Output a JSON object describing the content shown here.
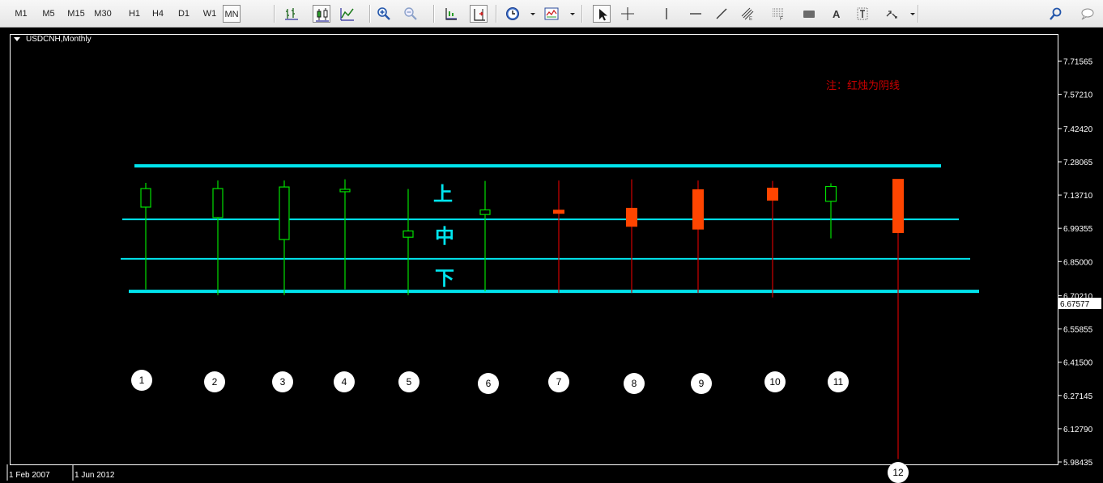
{
  "toolbar": {
    "timeframes": [
      "M1",
      "M5",
      "M15",
      "M30",
      "H1",
      "H4",
      "D1",
      "W1",
      "MN"
    ],
    "active_timeframe": "MN",
    "tools": [
      {
        "name": "bar-chart-icon",
        "active": false
      },
      {
        "name": "candlestick-chart-icon",
        "active": true
      },
      {
        "name": "line-chart-icon",
        "active": false
      },
      {
        "name": "zoom-in-icon",
        "active": false
      },
      {
        "name": "zoom-out-icon",
        "active": false
      },
      {
        "name": "chart-shift-icon",
        "active": false
      },
      {
        "name": "auto-scroll-icon",
        "active": true
      },
      {
        "name": "periods-clock-icon",
        "active": false
      },
      {
        "name": "indicators-icon",
        "active": false
      },
      {
        "name": "cursor-arrow-icon",
        "active": true
      },
      {
        "name": "crosshair-icon",
        "active": false
      },
      {
        "name": "vertical-line-icon",
        "active": false
      },
      {
        "name": "horizontal-line-icon",
        "active": false
      },
      {
        "name": "trendline-icon",
        "active": false
      },
      {
        "name": "equidistant-channel-icon",
        "active": false
      },
      {
        "name": "fibonacci-retracement-icon",
        "active": false
      },
      {
        "name": "rectangle-icon",
        "active": false
      },
      {
        "name": "text-icon",
        "active": false
      },
      {
        "name": "text-label-icon",
        "active": false
      },
      {
        "name": "arrows-icon",
        "active": false
      },
      {
        "name": "search-icon",
        "active": false
      },
      {
        "name": "chat-icon",
        "active": false
      }
    ]
  },
  "chart": {
    "symbol_label": "USDCNH,Monthly",
    "note": "注：红烛为阴线",
    "zone_labels": [
      "上",
      "中",
      "下"
    ],
    "current_price_label": "6.67577",
    "date_labels": [
      "1 Feb 2007",
      "1 Jun 2012"
    ],
    "colors": {
      "background": "#000000",
      "bull": "#00e000",
      "bear": "#ff4500",
      "bear_wick": "#d00000",
      "level_line": "#00e5ee",
      "note": "#cc0000",
      "axis_text": "#ffffff"
    }
  },
  "chart_data": {
    "type": "candlestick",
    "y_tick_labels": [
      "7.71565",
      "7.57210",
      "7.42420",
      "7.28065",
      "7.13710",
      "6.99355",
      "6.85000",
      "6.70210",
      "6.55855",
      "6.41500",
      "6.27145",
      "6.12790",
      "5.98435"
    ],
    "ylim": [
      5.98,
      7.78
    ],
    "horizontal_levels": [
      7.263,
      7.032,
      6.862,
      6.721
    ],
    "candles": [
      {
        "label": "1",
        "open": 7.085,
        "high": 7.19,
        "low": 6.73,
        "close": 7.165,
        "direction": "bull"
      },
      {
        "label": "2",
        "open": 7.04,
        "high": 7.2,
        "low": 6.705,
        "close": 7.165,
        "direction": "bull"
      },
      {
        "label": "3",
        "open": 6.945,
        "high": 7.2,
        "low": 6.705,
        "close": 7.172,
        "direction": "bull"
      },
      {
        "label": "4",
        "open": 7.158,
        "high": 7.205,
        "low": 6.73,
        "close": 7.162,
        "direction": "bull"
      },
      {
        "label": "5",
        "open": 6.955,
        "high": 7.163,
        "low": 6.705,
        "close": 6.982,
        "direction": "bull"
      },
      {
        "label": "6",
        "open": 7.053,
        "high": 7.198,
        "low": 6.721,
        "close": 7.073,
        "direction": "bull"
      },
      {
        "label": "7",
        "open": 7.072,
        "high": 7.2,
        "low": 6.715,
        "close": 7.058,
        "direction": "bear"
      },
      {
        "label": "8",
        "open": 7.08,
        "high": 7.205,
        "low": 6.715,
        "close": 7.002,
        "direction": "bear"
      },
      {
        "label": "9",
        "open": 7.16,
        "high": 7.2,
        "low": 6.715,
        "close": 6.99,
        "direction": "bear"
      },
      {
        "label": "10",
        "open": 7.167,
        "high": 7.198,
        "low": 6.695,
        "close": 7.115,
        "direction": "bear"
      },
      {
        "label": "11",
        "open": 7.11,
        "high": 7.188,
        "low": 6.95,
        "close": 7.174,
        "direction": "bull"
      },
      {
        "label": "12",
        "open": 7.205,
        "high": 7.205,
        "low": 5.997,
        "close": 6.975,
        "direction": "bear"
      }
    ]
  }
}
